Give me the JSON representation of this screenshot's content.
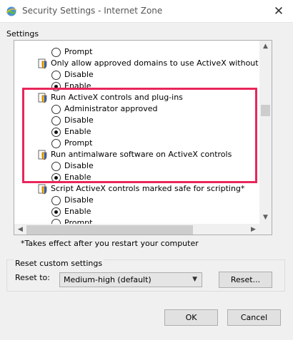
{
  "window": {
    "title": "Security Settings - Internet Zone",
    "close_glyph": "✕"
  },
  "settings": {
    "label": "Settings",
    "rows": [
      {
        "kind": "radio",
        "label": "Prompt",
        "checked": false
      },
      {
        "kind": "heading",
        "label": "Only allow approved domains to use ActiveX without prompt"
      },
      {
        "kind": "radio",
        "label": "Disable",
        "checked": false
      },
      {
        "kind": "radio",
        "label": "Enable",
        "checked": true
      },
      {
        "kind": "heading",
        "label": "Run ActiveX controls and plug-ins"
      },
      {
        "kind": "radio",
        "label": "Administrator approved",
        "checked": false
      },
      {
        "kind": "radio",
        "label": "Disable",
        "checked": false
      },
      {
        "kind": "radio",
        "label": "Enable",
        "checked": true
      },
      {
        "kind": "radio",
        "label": "Prompt",
        "checked": false
      },
      {
        "kind": "heading",
        "label": "Run antimalware software on ActiveX controls"
      },
      {
        "kind": "radio",
        "label": "Disable",
        "checked": false
      },
      {
        "kind": "radio",
        "label": "Enable",
        "checked": true
      },
      {
        "kind": "heading",
        "label": "Script ActiveX controls marked safe for scripting*"
      },
      {
        "kind": "radio",
        "label": "Disable",
        "checked": false
      },
      {
        "kind": "radio",
        "label": "Enable",
        "checked": true
      },
      {
        "kind": "radio",
        "label": "Prompt",
        "checked": false
      }
    ]
  },
  "note": "*Takes effect after you restart your computer",
  "reset": {
    "group_title": "Reset custom settings",
    "reset_to_label": "Reset to:",
    "selected": "Medium-high (default)",
    "reset_button": "Reset..."
  },
  "buttons": {
    "ok": "OK",
    "cancel": "Cancel"
  },
  "colors": {
    "highlight": "#e8265a",
    "window_bg": "#f0f0f0"
  },
  "icons": {
    "app": "ie-globe-icon",
    "setting": "activex-shield-icon"
  }
}
